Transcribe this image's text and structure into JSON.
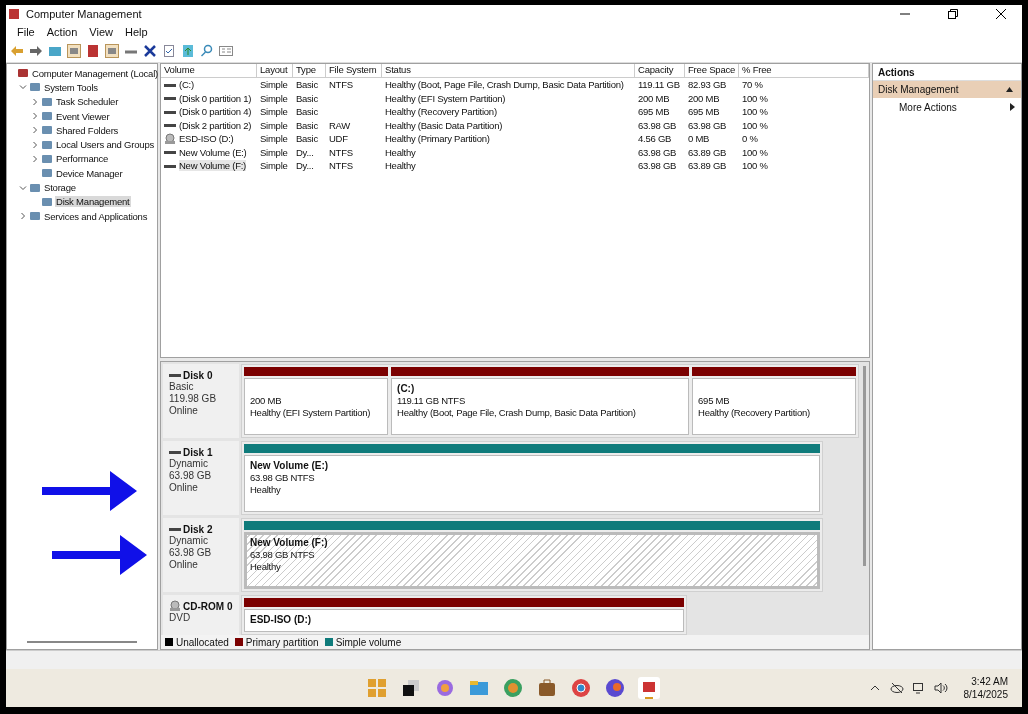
{
  "window": {
    "title": "Computer Management"
  },
  "menu": [
    "File",
    "Action",
    "View",
    "Help"
  ],
  "tree": [
    {
      "label": "Computer Management (Local)",
      "selected": false,
      "children": [
        {
          "label": "System Tools",
          "expanded": true,
          "selected": false,
          "children": [
            {
              "label": "Task Scheduler",
              "expanded": false,
              "selected": false
            },
            {
              "label": "Event Viewer",
              "expanded": false,
              "selected": false
            },
            {
              "label": "Shared Folders",
              "expanded": false,
              "selected": false
            },
            {
              "label": "Local Users and Groups",
              "expanded": false,
              "selected": false
            },
            {
              "label": "Performance",
              "expanded": false,
              "selected": false
            },
            {
              "label": "Device Manager",
              "selected": false
            }
          ]
        },
        {
          "label": "Storage",
          "expanded": true,
          "selected": false,
          "children": [
            {
              "label": "Disk Management",
              "selected": true
            }
          ]
        },
        {
          "label": "Services and Applications",
          "expanded": false,
          "selected": false
        }
      ]
    }
  ],
  "table": {
    "columns": [
      "Volume",
      "Layout",
      "Type",
      "File System",
      "Status",
      "Capacity",
      "Free Space",
      "% Free"
    ],
    "rows": [
      {
        "kind": "disk",
        "selected": false,
        "cells": [
          "(C:)",
          "Simple",
          "Basic",
          "NTFS",
          "Healthy (Boot, Page File, Crash Dump, Basic Data Partition)",
          "119.11 GB",
          "82.93 GB",
          "70 %"
        ]
      },
      {
        "kind": "disk",
        "selected": false,
        "cells": [
          "(Disk 0 partition 1)",
          "Simple",
          "Basic",
          "",
          "Healthy (EFI System Partition)",
          "200 MB",
          "200 MB",
          "100 %"
        ]
      },
      {
        "kind": "disk",
        "selected": false,
        "cells": [
          "(Disk 0 partition 4)",
          "Simple",
          "Basic",
          "",
          "Healthy (Recovery Partition)",
          "695 MB",
          "695 MB",
          "100 %"
        ]
      },
      {
        "kind": "disk",
        "selected": false,
        "cells": [
          "(Disk 2 partition 2)",
          "Simple",
          "Basic",
          "RAW",
          "Healthy (Basic Data Partition)",
          "63.98 GB",
          "63.98 GB",
          "100 %"
        ]
      },
      {
        "kind": "cd",
        "selected": false,
        "cells": [
          "ESD-ISO (D:)",
          "Simple",
          "Basic",
          "UDF",
          "Healthy (Primary Partition)",
          "4.56 GB",
          "0 MB",
          "0 %"
        ]
      },
      {
        "kind": "disk",
        "selected": false,
        "cells": [
          "New Volume (E:)",
          "Simple",
          "Dy...",
          "NTFS",
          "Healthy",
          "63.98 GB",
          "63.89 GB",
          "100 %"
        ]
      },
      {
        "kind": "disk",
        "selected": true,
        "cells": [
          "New Volume (F:)",
          "Simple",
          "Dy...",
          "NTFS",
          "Healthy",
          "63.98 GB",
          "63.89 GB",
          "100 %"
        ]
      }
    ]
  },
  "disks": [
    {
      "kind": "disk",
      "name": "Disk 0",
      "info": [
        "Basic",
        "119.98 GB",
        "Online"
      ],
      "partitions": [
        {
          "kind": "primary",
          "selected": false,
          "lines": [
            "200 MB",
            "Healthy (EFI System Partition)"
          ]
        },
        {
          "kind": "primary",
          "selected": false,
          "title": "(C:)",
          "lines": [
            "119.11 GB NTFS",
            "Healthy (Boot, Page File, Crash Dump, Basic Data Partition)"
          ]
        },
        {
          "kind": "primary",
          "selected": false,
          "lines": [
            "695 MB",
            "Healthy (Recovery Partition)"
          ]
        }
      ]
    },
    {
      "kind": "disk",
      "name": "Disk 1",
      "info": [
        "Dynamic",
        "63.98 GB",
        "Online"
      ],
      "partitions": [
        {
          "kind": "simple",
          "selected": false,
          "title": "New Volume  (E:)",
          "lines": [
            "63.98 GB NTFS",
            "Healthy"
          ]
        }
      ]
    },
    {
      "kind": "disk",
      "name": "Disk 2",
      "info": [
        "Dynamic",
        "63.98 GB",
        "Online"
      ],
      "partitions": [
        {
          "kind": "simple",
          "selected": true,
          "title": "New Volume  (F:)",
          "lines": [
            "63.98 GB NTFS",
            "Healthy"
          ]
        }
      ]
    },
    {
      "kind": "cd",
      "name": "CD-ROM 0",
      "info": [
        "DVD"
      ],
      "partitions": [
        {
          "kind": "primary",
          "selected": false,
          "title": "ESD-ISO  (D:)"
        }
      ]
    }
  ],
  "legend": [
    {
      "label": "Unallocated",
      "color": "#000000"
    },
    {
      "label": "Primary partition",
      "color": "#7b0000"
    },
    {
      "label": "Simple volume",
      "color": "#0f7b7b"
    }
  ],
  "actions": {
    "header": "Actions",
    "section": "Disk Management",
    "items": [
      "More Actions"
    ]
  },
  "clock": {
    "time": "3:42 AM",
    "date": "8/14/2025"
  }
}
